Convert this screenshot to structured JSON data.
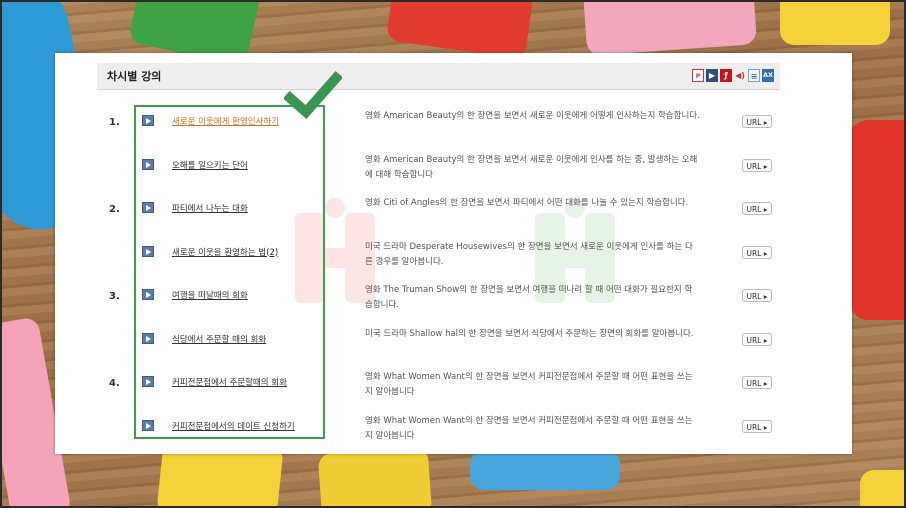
{
  "panel": {
    "title": "차시별 강의",
    "icons": [
      "pdf-icon",
      "video-icon",
      "flash-icon",
      "audio-icon",
      "document-icon",
      "ax-icon"
    ]
  },
  "lectures": [
    {
      "number": "1.",
      "title": "새로운 이웃에게 환영인사하기",
      "description": "영화 American Beauty의 한 장면을 보면서 새로운 이웃에게 어떻게 인사하는지 학습합니다.",
      "url_label": "URL"
    },
    {
      "number": "",
      "title": "오해를 일으키는 단어",
      "description": "영화 American Beauty의 한 장면을 보면서 새로운 이웃에게 인사를 하는 중, 발생하는 오해에 대해 학습합니다",
      "url_label": "URL"
    },
    {
      "number": "2.",
      "title": "파티에서 나누는 대화",
      "description": "영화 Citi of Angles의 한 장면을 보면서 파티에서 어떤 대화를 나눌 수 있는지 학습합니다.",
      "url_label": "URL"
    },
    {
      "number": "",
      "title": "새로운 이웃을 환영하는 법(2)",
      "description": "미국 드라마 Desperate Housewives의 한 장면을 보면서 새로운 이웃에게 인사를 하는 다른 경우를 알아봅니다.",
      "url_label": "URL"
    },
    {
      "number": "3.",
      "title": "여행을 떠날때의 회화",
      "description": "영화 The Truman Show의 한 장면을 보면서 여행을 떠나려 할 때 어떤 대화가 필요한지 학습합니다.",
      "url_label": "URL"
    },
    {
      "number": "",
      "title": "식당에서 주문할 때의 회화",
      "description": "미국 드라마 Shallow hal의 한 장면을 보면서 식당에서 주문하는 장면의 회화를 알아봅니다.",
      "url_label": "URL"
    },
    {
      "number": "4.",
      "title": "커피전문점에서 주문할때의 회화",
      "description": "영화 What Women Want의 한 장면을 보면서 커피전문점에서 주문할 때 어떤 표현을 쓰는지 알아봅니다",
      "url_label": "URL"
    },
    {
      "number": "",
      "title": "커피전문점에서의 데이트 신청하기",
      "description": "영화 What Women Want의 한 장면을 보면서 커피전문점에서 주문할 때 어떤 표현을 쓰는지 알아봅니다",
      "url_label": "URL"
    }
  ],
  "colors": {
    "highlight": "#3d9e4c",
    "active_link": "#d0751f",
    "play_icon": "#5d7da7"
  }
}
